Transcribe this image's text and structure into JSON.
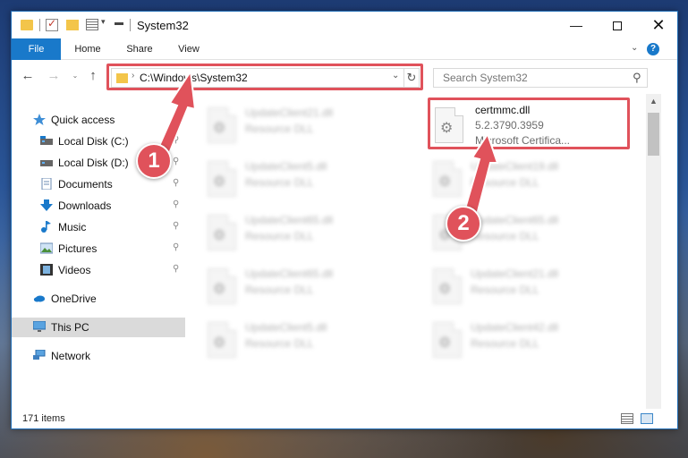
{
  "window": {
    "title": "System32",
    "minimize": "—",
    "close": "✕"
  },
  "ribbon": {
    "tabs": [
      "File",
      "Home",
      "Share",
      "View"
    ],
    "help": "?"
  },
  "navigation": {
    "back": "←",
    "forward": "→",
    "recent": "⌄",
    "up": "↑",
    "address": "C:\\Windows\\System32",
    "address_dropdown": "⌄",
    "refresh": "↻",
    "search_placeholder": "Search System32",
    "search_icon": "⚲"
  },
  "sidebar": {
    "items": [
      {
        "label": "Quick access",
        "icon": "star-icon"
      },
      {
        "label": "Local Disk (C:)",
        "icon": "drive-icon"
      },
      {
        "label": "Local Disk (D:)",
        "icon": "drive-icon"
      },
      {
        "label": "Documents",
        "icon": "documents-icon"
      },
      {
        "label": "Downloads",
        "icon": "downloads-icon"
      },
      {
        "label": "Music",
        "icon": "music-icon"
      },
      {
        "label": "Pictures",
        "icon": "pictures-icon"
      },
      {
        "label": "Videos",
        "icon": "videos-icon"
      },
      {
        "label": "OneDrive",
        "icon": "cloud-icon"
      },
      {
        "label": "This PC",
        "icon": "computer-icon"
      },
      {
        "label": "Network",
        "icon": "network-icon"
      }
    ],
    "pin": "📌"
  },
  "files": [
    {
      "name": "UpdateClient21.dll",
      "type": "Resource DLL"
    },
    {
      "name": "UpdateClient5.dll",
      "type": "Resource DLL"
    },
    {
      "name": "UpdateClient65.dll",
      "type": "Resource DLL"
    },
    {
      "name": "UpdateClient65.dll",
      "type": "Resource DLL"
    },
    {
      "name": "UpdateClient5.dll",
      "type": "Resource DLL"
    },
    {
      "name": "UpdateClient19.dll",
      "type": "Resource DLL"
    },
    {
      "name": "UpdateClient65.dll",
      "type": "Resource DLL"
    },
    {
      "name": "UpdateClient21.dll",
      "type": "Resource DLL"
    },
    {
      "name": "UpdateClient42.dll",
      "type": "Resource DLL"
    }
  ],
  "target_file": {
    "name": "certmmc.dll",
    "version": "5.2.3790.3959",
    "description": "Microsoft Certifica..."
  },
  "status": {
    "item_count": "171 items"
  },
  "annotations": {
    "step1": "1",
    "step2": "2",
    "color": "#e0525b"
  },
  "colors": {
    "accent": "#1979ca",
    "folder": "#f3c54a",
    "highlight": "#e0525b"
  }
}
